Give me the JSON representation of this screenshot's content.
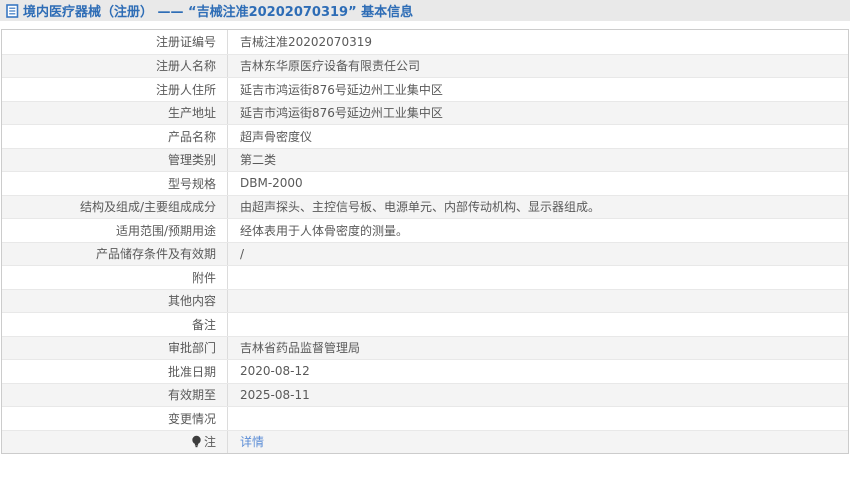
{
  "header": {
    "title": "境内医疗器械（注册） —— “吉械注准20202070319” 基本信息",
    "icon": "document-icon",
    "title_color": "#2e6db6",
    "bar_color": "#e9e9e9"
  },
  "table": {
    "stripe_color": "#f4f4f4",
    "border_color": "#cccccc",
    "rows": [
      {
        "label": "注册证编号",
        "value": "吉械注准20202070319"
      },
      {
        "label": "注册人名称",
        "value": "吉林东华原医疗设备有限责任公司"
      },
      {
        "label": "注册人住所",
        "value": "延吉市鸿运街876号延边州工业集中区"
      },
      {
        "label": "生产地址",
        "value": "延吉市鸿运街876号延边州工业集中区"
      },
      {
        "label": "产品名称",
        "value": "超声骨密度仪"
      },
      {
        "label": "管理类别",
        "value": "第二类"
      },
      {
        "label": "型号规格",
        "value": "DBM-2000"
      },
      {
        "label": "结构及组成/主要组成成分",
        "value": "由超声探头、主控信号板、电源单元、内部传动机构、显示器组成。"
      },
      {
        "label": "适用范围/预期用途",
        "value": "经体表用于人体骨密度的测量。"
      },
      {
        "label": "产品储存条件及有效期",
        "value": "/"
      },
      {
        "label": "附件",
        "value": ""
      },
      {
        "label": "其他内容",
        "value": ""
      },
      {
        "label": "备注",
        "value": ""
      },
      {
        "label": "审批部门",
        "value": "吉林省药品监督管理局"
      },
      {
        "label": "批准日期",
        "value": "2020-08-12"
      },
      {
        "label": "有效期至",
        "value": "2025-08-11"
      },
      {
        "label": "变更情况",
        "value": ""
      }
    ],
    "note_row": {
      "label": "注",
      "icon": "bulb-icon",
      "link_label": "详情",
      "link_color": "#5b8dd6"
    }
  }
}
